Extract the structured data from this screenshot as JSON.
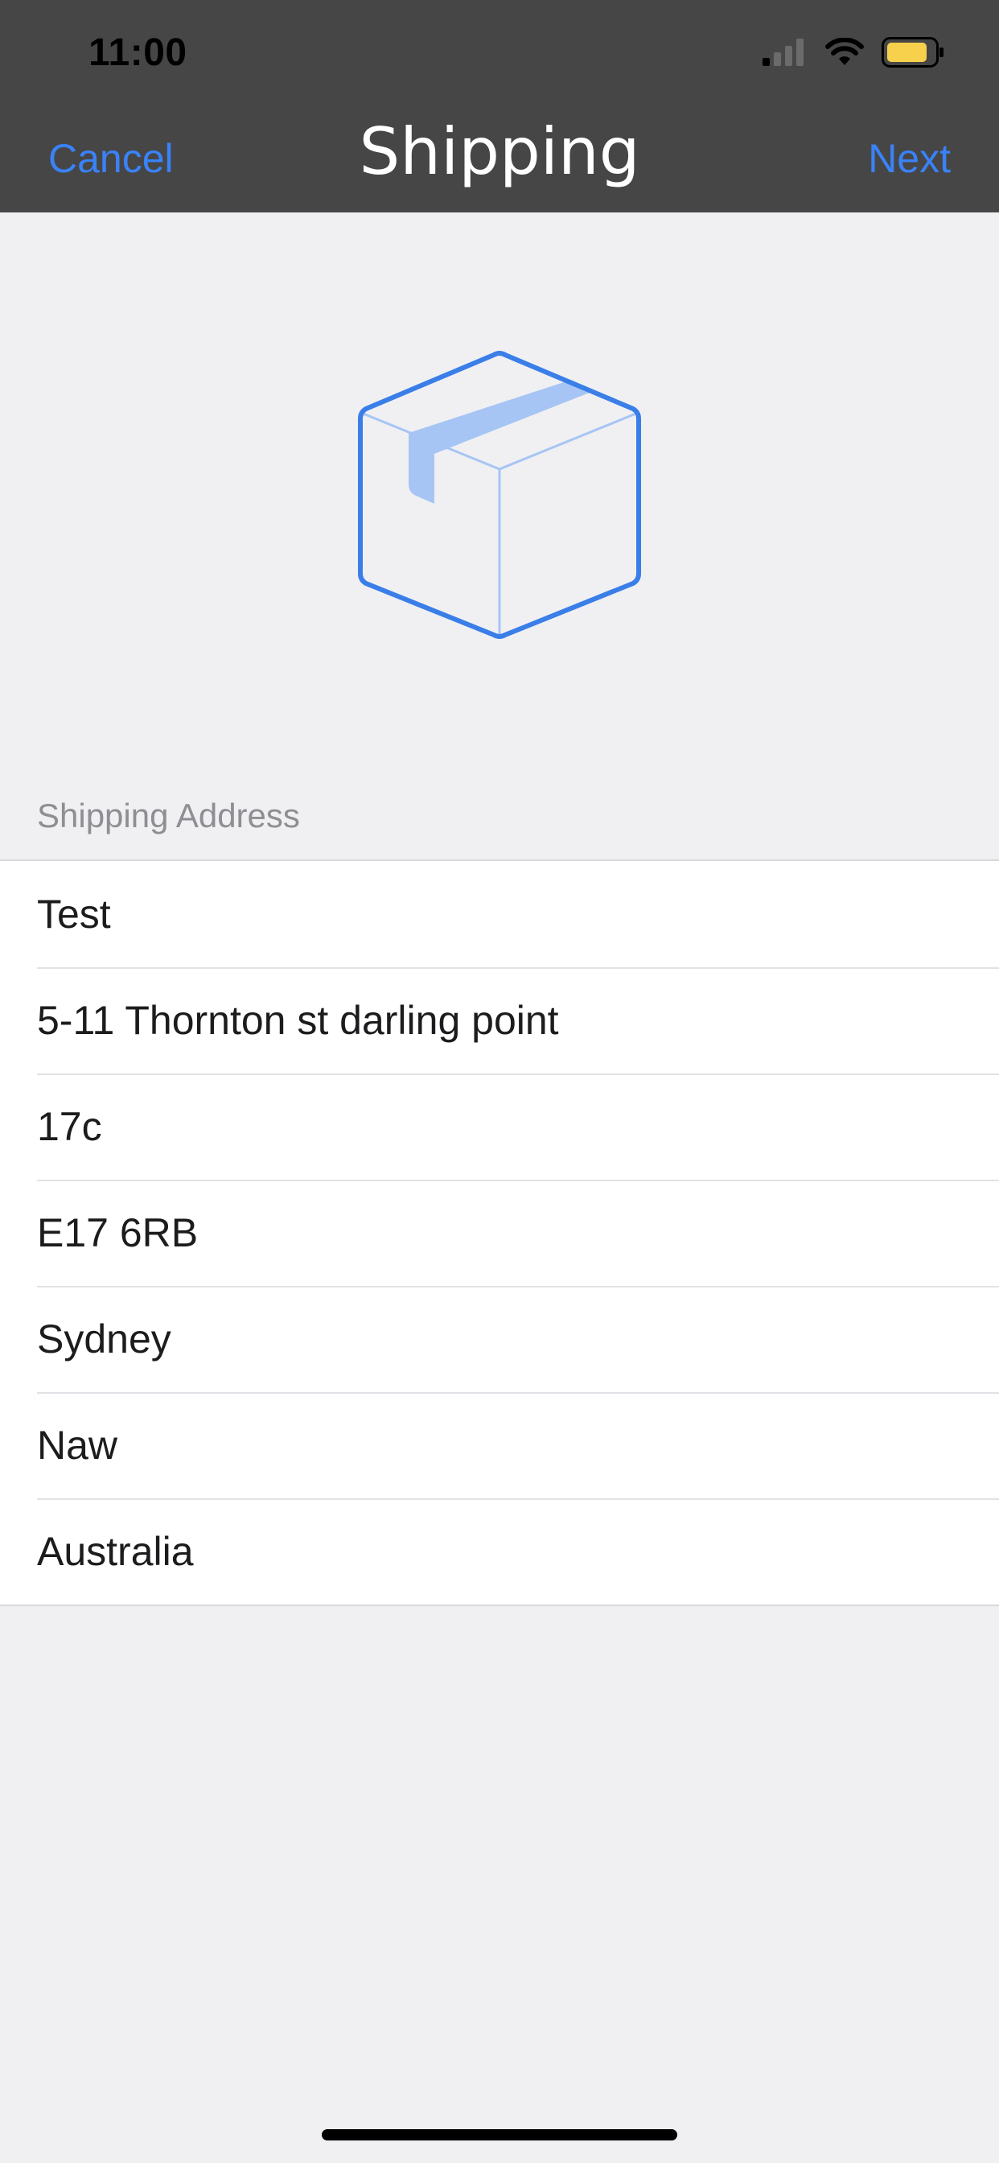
{
  "status_bar": {
    "time": "11:00",
    "icons": [
      "signal-icon",
      "wifi-icon",
      "battery-icon"
    ]
  },
  "nav": {
    "cancel_label": "Cancel",
    "title": "Shipping",
    "next_label": "Next"
  },
  "hero": {
    "icon": "package-box-icon"
  },
  "shipping_address": {
    "header": "Shipping Address",
    "fields": [
      "Test",
      "5-11 Thornton st darling point",
      "17c",
      "E17 6RB",
      "Sydney",
      "Naw",
      "Australia"
    ]
  },
  "colors": {
    "accent": "#3a82f7",
    "header_background": "#464646",
    "page_background": "#f0f0f3",
    "battery": "#f7d14c"
  }
}
